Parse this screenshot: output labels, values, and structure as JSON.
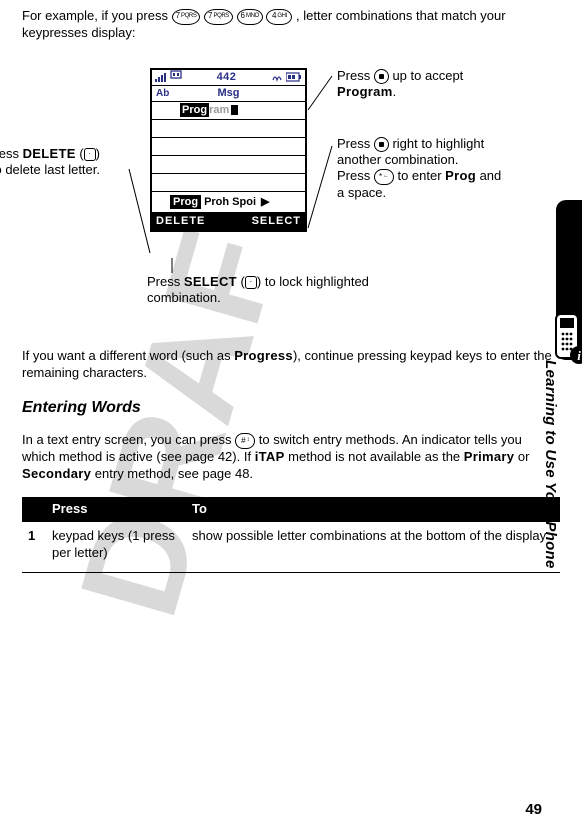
{
  "intro": {
    "prefix": "For example, if you press ",
    "keys": [
      "7 PQRS",
      "7 PQRS",
      "6 MNO",
      "4 GHI"
    ],
    "suffix": ", letter combinations that match your keypresses display:"
  },
  "screen": {
    "status_number": "442",
    "title_left": "Ab",
    "title": "Msg",
    "typed_dark": "Prog",
    "typed_ghost": "ram",
    "sug_highlight": "Prog",
    "sug_rest": "Proh Spoi",
    "softkey_left": "DELETE",
    "softkey_right": "SELECT"
  },
  "callouts": {
    "left_pre": "Press ",
    "left_bold": "DELETE",
    "left_post": " (",
    "left_key": "–",
    "left_tail": ") to delete last letter.",
    "tr_pre": "Press ",
    "tr_mid": " up to accept ",
    "tr_bold": "Program",
    "tr_end": ".",
    "r2_a_pre": "Press ",
    "r2_a_mid": " right to highlight another combination.",
    "r2_b_pre": "Press ",
    "r2_b_key": "* ←",
    "r2_b_mid": " to enter ",
    "r2_b_bold": "Prog",
    "r2_b_end": " and a space.",
    "bot_pre": "Press ",
    "bot_bold": "SELECT",
    "bot_post": " (",
    "bot_key": "+",
    "bot_tail": ") to lock highlighted combination."
  },
  "body": {
    "para1_a": "If you want a different word (such as ",
    "para1_bold": "Progress",
    "para1_b": "), continue pressing keypad keys to enter the remaining characters.",
    "heading": "Entering Words",
    "para2_a": "In a text entry screen, you can press ",
    "para2_key": "# ↕",
    "para2_b": " to switch entry methods. An indicator tells you which method is active (see page 42). If ",
    "para2_bold1": "iTAP",
    "para2_c": " method is not available as the ",
    "para2_bold2": "Primary",
    "para2_d": " or ",
    "para2_bold3": "Secondary",
    "para2_e": " entry method, see page 48."
  },
  "table": {
    "head_press": "Press",
    "head_to": "To",
    "row1_num": "1",
    "row1_press": "keypad keys (1 press per letter)",
    "row1_to": "show possible letter combinations at the bottom of the display"
  },
  "sidebar": "Learning to Use Your Phone",
  "page_number": "49"
}
